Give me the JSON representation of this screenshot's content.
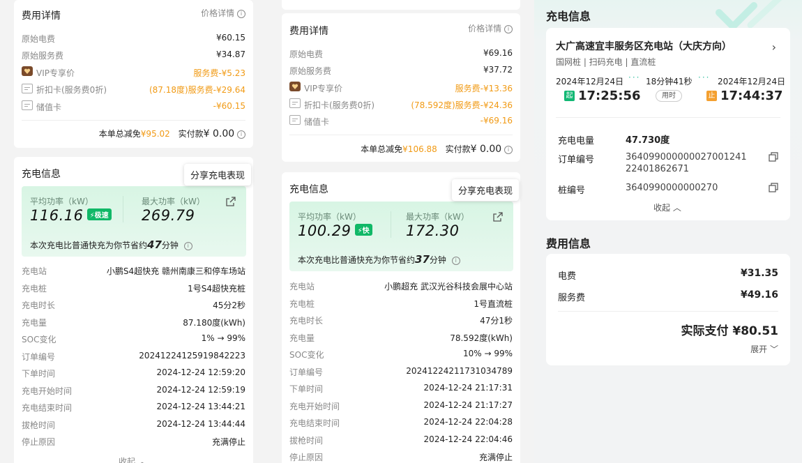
{
  "order1": {
    "fee_title": "费用详情",
    "price_link": "价格详情",
    "fees": [
      {
        "label": "原始电费",
        "value": "¥60.15"
      },
      {
        "label": "原始服务费",
        "value": "¥34.87"
      },
      {
        "label": "VIP专享价",
        "value": "服务费-¥5.23"
      },
      {
        "label": "折扣卡(服务费0折)",
        "value": "(87.18度)服务费-¥29.64"
      },
      {
        "label": "储值卡",
        "value": "-¥60.15"
      }
    ],
    "total_discount_label": "本单总减免",
    "total_discount": "¥95.02",
    "paid_label": "实付款",
    "paid_value": "¥ 0.00",
    "charge_title": "充电信息",
    "share_label": "分享充电表现",
    "avg_power_label": "平均功率（kW）",
    "avg_power": "116.16",
    "speed_badge": "极速",
    "max_power_label": "最大功率（kW）",
    "max_power": "269.79",
    "saving_prefix": "本次充电比普通快充为你节省约",
    "saving_minutes": "47",
    "saving_suffix": "分钟",
    "details": [
      {
        "label": "充电站",
        "value": "小鹏S4超快充 赣州南康三和停车场站"
      },
      {
        "label": "充电桩",
        "value": "1号S4超快充桩"
      },
      {
        "label": "充电时长",
        "value": "45分2秒"
      },
      {
        "label": "充电量",
        "value": "87.180度(kWh)"
      },
      {
        "label": "SOC变化",
        "value": "1% → 99%"
      },
      {
        "label": "订单编号",
        "value": "20241224125919842223"
      },
      {
        "label": "下单时间",
        "value": "2024-12-24 12:59:20"
      },
      {
        "label": "充电开始时间",
        "value": "2024-12-24 12:59:19"
      },
      {
        "label": "充电结束时间",
        "value": "2024-12-24 13:44:21"
      },
      {
        "label": "拔枪时间",
        "value": "2024-12-24 13:44:44"
      },
      {
        "label": "停止原因",
        "value": "充满停止"
      }
    ],
    "collapse_label": "收起"
  },
  "order2": {
    "fee_title": "费用详情",
    "price_link": "价格详情",
    "fees": [
      {
        "label": "原始电费",
        "value": "¥69.16"
      },
      {
        "label": "原始服务费",
        "value": "¥37.72"
      },
      {
        "label": "VIP专享价",
        "value": "服务费-¥13.36"
      },
      {
        "label": "折扣卡(服务费0折)",
        "value": "(78.592度)服务费-¥24.36"
      },
      {
        "label": "储值卡",
        "value": "-¥69.16"
      }
    ],
    "total_discount_label": "本单总减免",
    "total_discount": "¥106.88",
    "paid_label": "实付款",
    "paid_value": "¥ 0.00",
    "charge_title": "充电信息",
    "share_label": "分享充电表现",
    "avg_power_label": "平均功率（kW）",
    "avg_power": "100.29",
    "speed_badge": "快",
    "max_power_label": "最大功率（kW）",
    "max_power": "172.30",
    "saving_prefix": "本次充电比普通快充为你节省约",
    "saving_minutes": "37",
    "saving_suffix": "分钟",
    "details": [
      {
        "label": "充电站",
        "value": "小鹏超充 武汉光谷科技会展中心站"
      },
      {
        "label": "充电桩",
        "value": "1号直流桩"
      },
      {
        "label": "充电时长",
        "value": "47分1秒"
      },
      {
        "label": "充电量",
        "value": "78.592度(kWh)"
      },
      {
        "label": "SOC变化",
        "value": "10% → 99%"
      },
      {
        "label": "订单编号",
        "value": "20241224211731034789"
      },
      {
        "label": "下单时间",
        "value": "2024-12-24 21:17:31"
      },
      {
        "label": "充电开始时间",
        "value": "2024-12-24 21:17:27"
      },
      {
        "label": "充电结束时间",
        "value": "2024-12-24 22:04:28"
      },
      {
        "label": "拔枪时间",
        "value": "2024-12-24 22:04:46"
      },
      {
        "label": "停止原因",
        "value": "充满停止"
      }
    ]
  },
  "order3": {
    "charge_title": "充电信息",
    "station_name": "大广高速宜丰服务区充电站（大庆方向）",
    "station_tags": "国网桩 | 扫码充电 | 直流桩",
    "start_date": "2024年12月24日",
    "end_date": "2024年12月24日",
    "duration": "18分钟41秒",
    "duration_label": "用时",
    "start_badge": "起",
    "end_badge": "止",
    "start_time": "17:25:56",
    "end_time": "17:44:37",
    "energy_label": "充电电量",
    "energy_value": "47.730度",
    "order_no_label": "订单编号",
    "order_no_line1": "364099000000027001241",
    "order_no_line2": "22401862671",
    "pile_no_label": "桩编号",
    "pile_no_value": "3640990000000270",
    "collapse_label": "收起",
    "fee_title": "费用信息",
    "elec_fee_label": "电费",
    "elec_fee_value": "¥31.35",
    "service_fee_label": "服务费",
    "service_fee_value": "¥49.16",
    "total_label": "实际支付",
    "total_value": "¥80.51",
    "expand_label": "展开"
  },
  "colors": {
    "accent_orange": "#f19a14",
    "accent_green": "#10b867",
    "badge_start": "#12b874",
    "badge_end": "#f4a030"
  }
}
